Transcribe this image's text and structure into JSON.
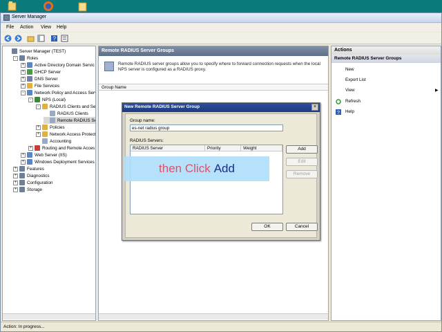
{
  "window": {
    "title": "Server Manager"
  },
  "menu": {
    "file": "File",
    "action": "Action",
    "view": "View",
    "help": "Help"
  },
  "tree": [
    {
      "label": "Server Manager (TEST)",
      "indent": 0,
      "expander": "",
      "color": "#6f7f99"
    },
    {
      "label": "Roles",
      "indent": 1,
      "expander": "-",
      "color": "#6f7f99"
    },
    {
      "label": "Active Directory Domain Servic",
      "indent": 2,
      "expander": "+",
      "color": "#5c86c0"
    },
    {
      "label": "DHCP Server",
      "indent": 2,
      "expander": "+",
      "color": "#4a9a4a"
    },
    {
      "label": "DNS Server",
      "indent": 2,
      "expander": "+",
      "color": "#7a7aa8"
    },
    {
      "label": "File Services",
      "indent": 2,
      "expander": "+",
      "color": "#e0b040"
    },
    {
      "label": "Network Policy and Access Serv",
      "indent": 2,
      "expander": "-",
      "color": "#5c86c0"
    },
    {
      "label": "NPS (Local)",
      "indent": 3,
      "expander": "-",
      "color": "#3a8a3a"
    },
    {
      "label": "RADIUS Clients and Ser",
      "indent": 4,
      "expander": "-",
      "color": "#e0b040"
    },
    {
      "label": "RADIUS Clients",
      "indent": 5,
      "expander": "",
      "color": "#9aaac0"
    },
    {
      "label": "Remote RADIUS Se",
      "indent": 5,
      "expander": "",
      "color": "#9aaac0"
    },
    {
      "label": "Policies",
      "indent": 4,
      "expander": "+",
      "color": "#e0b040"
    },
    {
      "label": "Network Access Protect",
      "indent": 4,
      "expander": "+",
      "color": "#e0b040"
    },
    {
      "label": "Accounting",
      "indent": 4,
      "expander": "",
      "color": "#9aaac0"
    },
    {
      "label": "Routing and Remote Acces",
      "indent": 3,
      "expander": "+",
      "color": "#c04040"
    },
    {
      "label": "Web Server (IIS)",
      "indent": 2,
      "expander": "+",
      "color": "#5c86c0"
    },
    {
      "label": "Windows Deployment Services",
      "indent": 2,
      "expander": "+",
      "color": "#5c86c0"
    },
    {
      "label": "Features",
      "indent": 1,
      "expander": "+",
      "color": "#6f7f99"
    },
    {
      "label": "Diagnostics",
      "indent": 1,
      "expander": "+",
      "color": "#6f7f99"
    },
    {
      "label": "Configuration",
      "indent": 1,
      "expander": "+",
      "color": "#6f7f99"
    },
    {
      "label": "Storage",
      "indent": 1,
      "expander": "+",
      "color": "#6f7f99"
    }
  ],
  "center": {
    "title": "Remote RADIUS Server Groups",
    "description": "Remote RADIUS server groups allow you to specify where to forward connection requests when the local NPS server is configured as a RADIUS proxy.",
    "column": "Group Name"
  },
  "actions": {
    "header": "Actions",
    "section": "Remote RADIUS Server Groups",
    "items": [
      "New",
      "Export List",
      "View",
      "Refresh",
      "Help"
    ]
  },
  "dialog": {
    "title": "New Remote RADIUS Server Group",
    "group_label": "Group name:",
    "group_value": "es-net radius group",
    "servers_label": "RADIUS Servers:",
    "columns": [
      "RADIUS Server",
      "Priority",
      "Weight"
    ],
    "add": "Add",
    "edit": "Edit",
    "remove": "Remove",
    "ok": "OK",
    "cancel": "Cancel"
  },
  "overlay": {
    "part1": "then Click",
    "part2": "Add"
  },
  "status": "Action:  In progress..."
}
